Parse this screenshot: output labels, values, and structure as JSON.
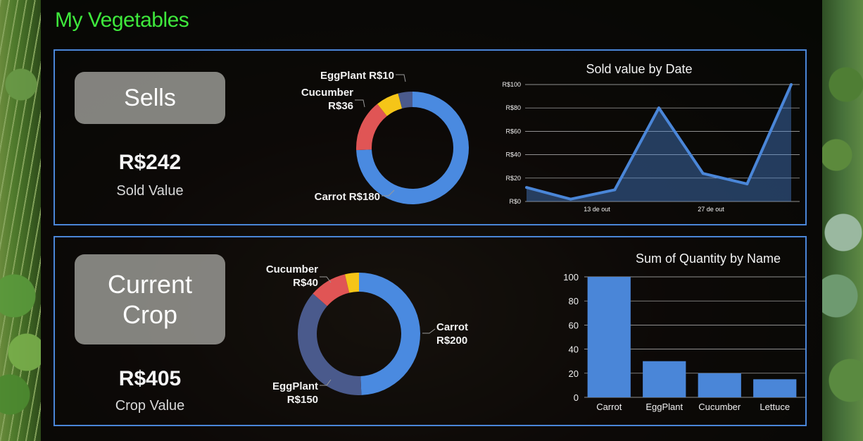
{
  "app": {
    "title": "My Vegetables"
  },
  "colors": {
    "accent": "#4a86d8",
    "title_green": "#3ee83c",
    "carrot": "#4a8ae0",
    "eggplant": "#4a5a8c",
    "cucumber": "#e05555",
    "lettuce": "#f5c518"
  },
  "sells": {
    "box_label": "Sells",
    "value": "R$242",
    "value_label": "Sold Value"
  },
  "crop": {
    "box_label": "Current\nCrop",
    "value": "R$405",
    "value_label": "Crop Value"
  },
  "chart_data": [
    {
      "type": "pie",
      "variant": "donut",
      "title": "",
      "slices": [
        {
          "name": "Carrot",
          "value": 180,
          "label": "Carrot R$180",
          "color": "#4a8ae0"
        },
        {
          "name": "Cucumber",
          "value": 36,
          "label": "Cucumber R$36",
          "color": "#e05555"
        },
        {
          "name": "Lettuce",
          "value": 16,
          "label": "",
          "color": "#f5c518"
        },
        {
          "name": "EggPlant",
          "value": 10,
          "label": "EggPlant R$10",
          "color": "#4a5a8c"
        }
      ]
    },
    {
      "type": "area",
      "title": "Sold value by Date",
      "xlabel": "",
      "ylabel": "",
      "x_tick_labels": [
        "13 de out",
        "27 de out"
      ],
      "y_ticks": [
        "R$0",
        "R$20",
        "R$40",
        "R$60",
        "R$80",
        "R$100"
      ],
      "ylim": [
        0,
        100
      ],
      "values": [
        12,
        2,
        10,
        80,
        24,
        15,
        100
      ],
      "color": "#4a86d8",
      "grid": true
    },
    {
      "type": "pie",
      "variant": "donut",
      "title": "",
      "slices": [
        {
          "name": "Carrot",
          "value": 200,
          "label": "Carrot R$200",
          "color": "#4a8ae0"
        },
        {
          "name": "EggPlant",
          "value": 150,
          "label": "EggPlant R$150",
          "color": "#4a5a8c"
        },
        {
          "name": "Cucumber",
          "value": 40,
          "label": "Cucumber R$40",
          "color": "#e05555"
        },
        {
          "name": "Lettuce",
          "value": 15,
          "label": "",
          "color": "#f5c518"
        }
      ]
    },
    {
      "type": "bar",
      "title": "Sum of Quantity by Name",
      "xlabel": "",
      "ylabel": "",
      "categories": [
        "Carrot",
        "EggPlant",
        "Cucumber",
        "Lettuce"
      ],
      "values": [
        100,
        30,
        20,
        15
      ],
      "ylim": [
        0,
        100
      ],
      "y_ticks": [
        "0",
        "20",
        "40",
        "60",
        "80",
        "100"
      ],
      "color": "#4a86d8",
      "grid": true
    }
  ]
}
